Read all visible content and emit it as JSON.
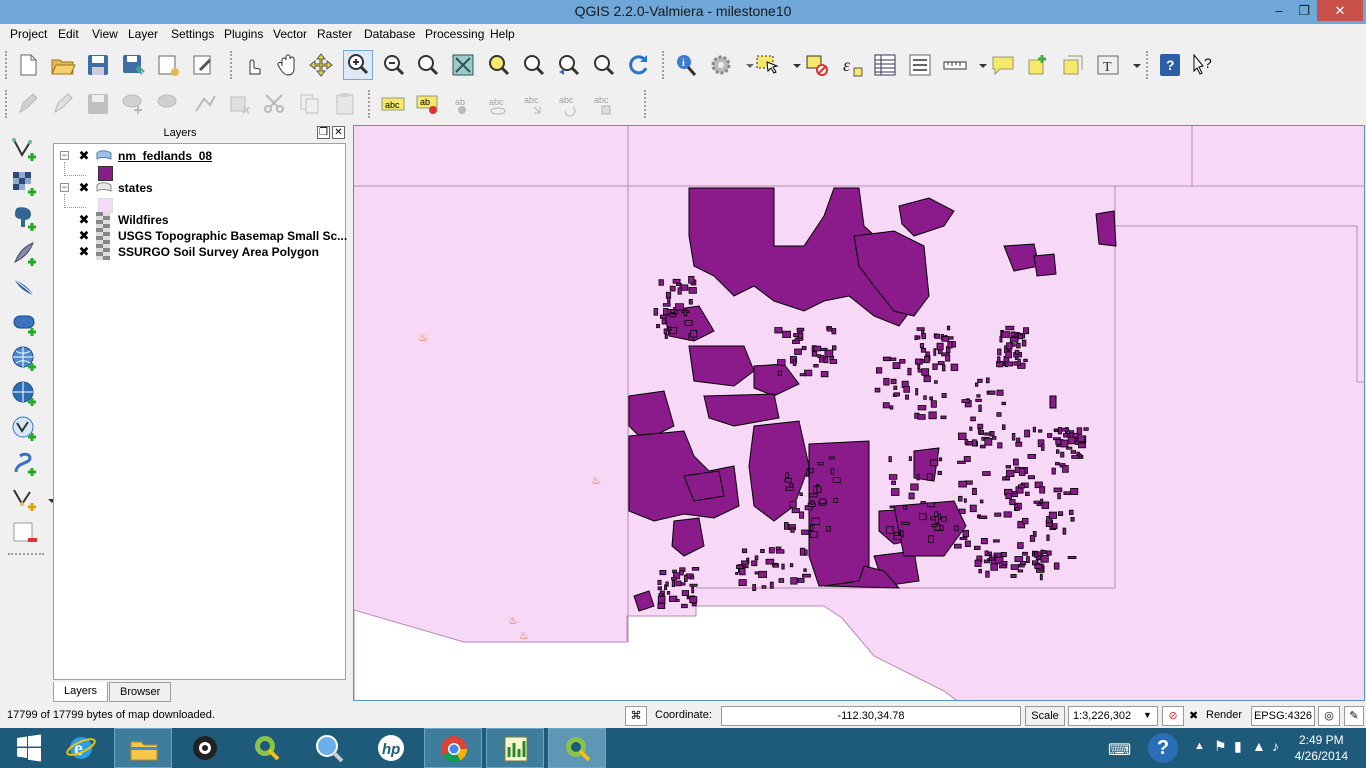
{
  "window": {
    "title": "QGIS 2.2.0-Valmiera - milestone10",
    "minimize": "–",
    "maximize": "❐",
    "close": "✕"
  },
  "menu": [
    "Project",
    "Edit",
    "View",
    "Layer",
    "Settings",
    "Plugins",
    "Vector",
    "Raster",
    "Database",
    "Processing",
    "Help"
  ],
  "toolbar_icons": {
    "row1": [
      "new-project-icon",
      "open-project-icon",
      "save-project-icon",
      "save-as-icon",
      "new-print-composer-icon",
      "composer-manager-icon",
      "touch-zoom-icon",
      "pan-map-icon",
      "pan-to-selection-icon",
      "zoom-in-icon",
      "zoom-out-icon",
      "zoom-actual-size-icon",
      "zoom-full-icon",
      "zoom-to-selection-icon",
      "zoom-to-layer-icon",
      "zoom-last-icon",
      "zoom-next-icon",
      "refresh-icon",
      "identify-icon",
      "run-action-icon",
      "select-features-icon",
      "deselect-icon",
      "field-calculator-icon",
      "attribute-table-icon",
      "statistics-icon",
      "measure-line-icon",
      "map-tips-icon",
      "new-bookmark-icon",
      "show-bookmarks-icon",
      "text-annotation-icon",
      "help-contents-icon",
      "whats-this-icon"
    ],
    "row2": [
      "current-edits-icon",
      "toggle-editing-icon",
      "save-layer-edits-icon",
      "add-feature-icon",
      "move-feature-icon",
      "node-tool-icon",
      "delete-selected-icon",
      "cut-features-icon",
      "copy-features-icon",
      "paste-features-icon",
      "layer-labeling-icon",
      "label-pin-icon",
      "label-highlight-icon",
      "label-show-hide-icon",
      "label-move-icon",
      "label-rotate-icon",
      "label-change-icon"
    ],
    "left": [
      "add-vector-layer-icon",
      "add-raster-layer-icon",
      "add-postgis-layer-icon",
      "add-spatialite-layer-icon",
      "add-mssql-layer-icon",
      "add-oracle-layer-icon",
      "add-wms-layer-icon",
      "add-wcs-layer-icon",
      "add-wfs-layer-icon",
      "add-delimited-text-icon",
      "new-shapefile-layer-icon",
      "remove-layer-icon"
    ]
  },
  "layers_panel": {
    "title": "Layers",
    "layers": [
      {
        "name": "nm_fedlands_08",
        "checked": "✖",
        "swatch": "#8b1a8b",
        "kind": "vector"
      },
      {
        "name": "states",
        "checked": "✖",
        "swatch": "#f5d9f5",
        "kind": "vector"
      },
      {
        "name": "Wildfires",
        "checked": "✖",
        "kind": "raster"
      },
      {
        "name": "USGS Topographic Basemap Small Sc...",
        "checked": "✖",
        "kind": "raster"
      },
      {
        "name": "SSURGO Soil Survey Area Polygon",
        "checked": "✖",
        "kind": "raster"
      }
    ],
    "tabs": [
      "Layers",
      "Browser"
    ]
  },
  "map": {
    "background": "#f7d9f7",
    "fedlands_color": "#8b1a8b",
    "outline_color": "#000000"
  },
  "statusbar": {
    "message": "17799 of 17799 bytes of map downloaded.",
    "coordinate_label": "Coordinate:",
    "coordinate": "-112.30,34.78",
    "scale_label": "Scale",
    "scale": "1:3,226,302",
    "render_label": "Render",
    "render_checked": "✖",
    "crs": "EPSG:4326"
  },
  "taskbar": {
    "apps": [
      "start-icon",
      "internet-explorer-icon",
      "file-explorer-icon",
      "webcam-app-icon",
      "qgis-app-icon",
      "magnifier-app-icon",
      "hp-app-icon",
      "chrome-app-icon",
      "chart-app-icon",
      "qgis-active-icon"
    ],
    "time": "2:49 PM",
    "date": "4/26/2014"
  }
}
